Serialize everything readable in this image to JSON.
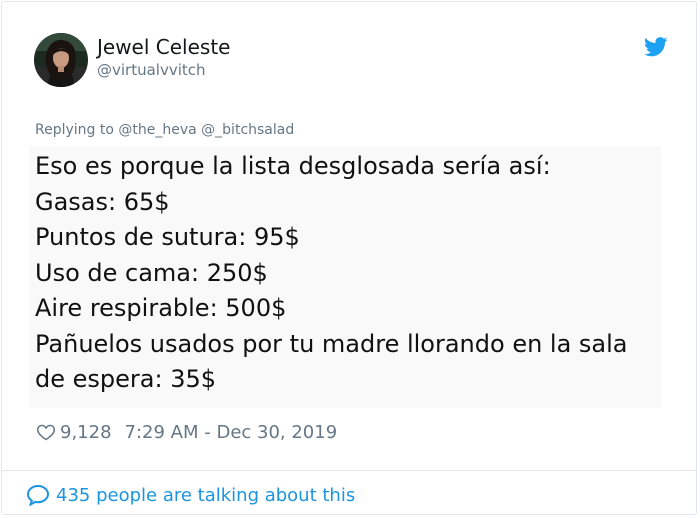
{
  "author": {
    "display_name": "Jewel Celeste",
    "handle": "@virtualvvitch"
  },
  "reply_context": {
    "prefix": "Replying to",
    "mentions": [
      "@the_heva",
      "@_bitchsalad"
    ]
  },
  "tweet": {
    "lines": [
      "Eso es porque la lista desglosada sería así:",
      "Gasas: 65$",
      "Puntos de sutura: 95$",
      "Uso de cama: 250$",
      "Aire respirable: 500$",
      "Pañuelos usados por tu madre llorando en la sala",
      "de espera: 35$"
    ]
  },
  "meta": {
    "likes": "9,128",
    "timestamp": "7:29 AM - Dec 30, 2019"
  },
  "footer": {
    "talking_text": "435 people are talking about this"
  },
  "icons": {
    "bird": "twitter-bird-icon",
    "heart": "heart-outline-icon",
    "bubble": "speech-bubble-icon"
  },
  "colors": {
    "brand_blue": "#1da1f2",
    "link_blue": "#1b95e0",
    "muted_gray": "#657786",
    "body_bg": "#f9f9f9"
  }
}
